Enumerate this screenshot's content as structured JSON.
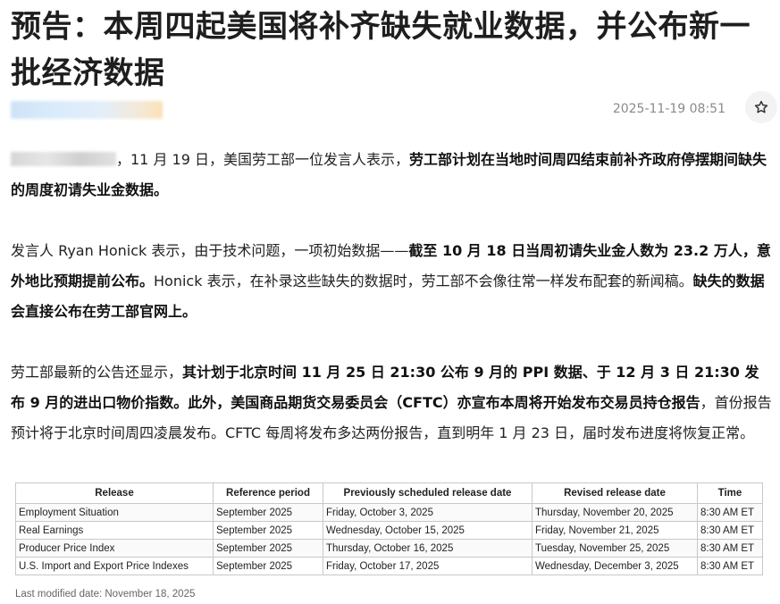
{
  "article": {
    "title": "预告：本周四起美国将补齐缺失就业数据，并公布新一批经济数据",
    "date": "2025-11-19 08:51",
    "favorite_icon": "star-icon"
  },
  "paragraphs": {
    "p1": {
      "a": "，11 月 19 日，美国劳工部一位发言人表示，",
      "b": "劳工部计划在当地时间周四结束前补齐政府停摆期间缺失的周度初请失业金数据。"
    },
    "p2": {
      "a": "发言人 Ryan Honick 表示，由于技术问题，一项初始数据——",
      "b": "截至 10 月 18 日当周初请失业金人数为 23.2 万人，意外地比预期提前公布。",
      "c": "Honick 表示，在补录这些缺失的数据时，劳工部不会像往常一样发布配套的新闻稿。",
      "d": "缺失的数据会直接公布在劳工部官网上。"
    },
    "p3": {
      "a": "劳工部最新的公告还显示，",
      "b": "其计划于北京时间 11 月 25 日 21:30 公布 9 月的 PPI 数据、于 12 月 3 日 21:30 发布 9 月的进出口物价指数。此外，美国商品期货交易委员会（CFTC）亦宣布本周将开始发布交易员持仓报告",
      "c": "，首份报告预计将于北京时间周四凌晨发布。CFTC 每周将发布多达两份报告，直到明年 1 月 23 日，届时发布进度将恢复正常。"
    }
  },
  "table": {
    "headers": [
      "Release",
      "Reference period",
      "Previously scheduled release date",
      "Revised release date",
      "Time"
    ],
    "rows": [
      [
        "Employment Situation",
        "September 2025",
        "Friday, October 3, 2025",
        "Thursday, November 20, 2025",
        "8:30 AM ET"
      ],
      [
        "Real Earnings",
        "September 2025",
        "Wednesday, October 15, 2025",
        "Friday, November 21, 2025",
        "8:30 AM ET"
      ],
      [
        "Producer Price Index",
        "September 2025",
        "Thursday, October 16, 2025",
        "Tuesday, November 25, 2025",
        "8:30 AM ET"
      ],
      [
        "U.S. Import and Export Price Indexes",
        "September 2025",
        "Friday, October 17, 2025",
        "Wednesday, December 3, 2025",
        "8:30 AM ET"
      ]
    ],
    "footnote": "Last modified date: November 18, 2025"
  }
}
